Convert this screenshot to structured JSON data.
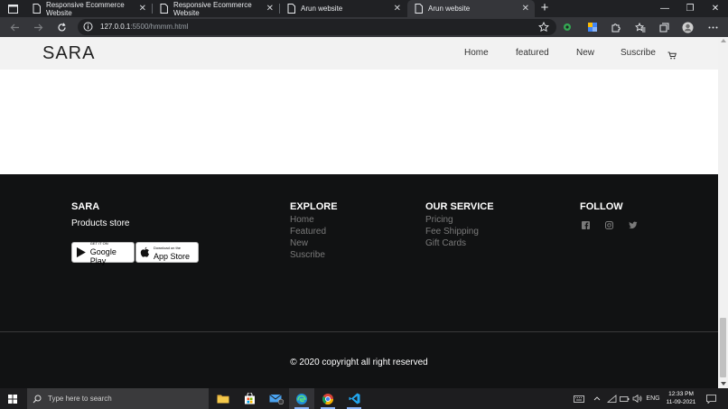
{
  "browser": {
    "tabs": [
      {
        "title": "Responsive Ecommerce Website",
        "active": false
      },
      {
        "title": "Responsive Ecommerce Website",
        "active": false
      },
      {
        "title": "Arun website",
        "active": false
      },
      {
        "title": "Arun website",
        "active": true
      }
    ],
    "close_glyph": "✕",
    "new_tab_glyph": "+",
    "window_controls": {
      "minimize": "—",
      "restore": "❐",
      "close": "✕"
    },
    "address": {
      "host": "127.0.0.1",
      "path": ":5500/hmmm.html"
    }
  },
  "site": {
    "brand": "SARA",
    "nav": [
      "Home",
      "featured",
      "New",
      "Suscribe"
    ]
  },
  "footer": {
    "brand": {
      "title": "SARA",
      "subtitle": "Products store"
    },
    "store_buttons": [
      {
        "small": "GET IT ON",
        "big": "Google Play"
      },
      {
        "small": "Download on the",
        "big": "App Store"
      }
    ],
    "explore": {
      "title": "EXPLORE",
      "links": [
        "Home",
        "Featured",
        "New",
        "Suscribe"
      ]
    },
    "service": {
      "title": "OUR SERVICE",
      "links": [
        "Pricing",
        "Fee Shipping",
        "Gift Cards"
      ]
    },
    "follow": {
      "title": "FOLLOW",
      "icons": [
        "facebook-icon",
        "instagram-icon",
        "twitter-icon"
      ]
    },
    "copyright": "© 2020 copyright all right reserved"
  },
  "taskbar": {
    "search_placeholder": "Type here to search",
    "language": "ENG",
    "time": "12:33 PM",
    "date": "11-09-2021"
  },
  "colors": {
    "footer_bg": "#111213",
    "nav_bg": "#f2f2f2",
    "link_muted": "#7a7a7a",
    "chrome_dark": "#202124",
    "chrome_toolbar": "#35363a"
  }
}
